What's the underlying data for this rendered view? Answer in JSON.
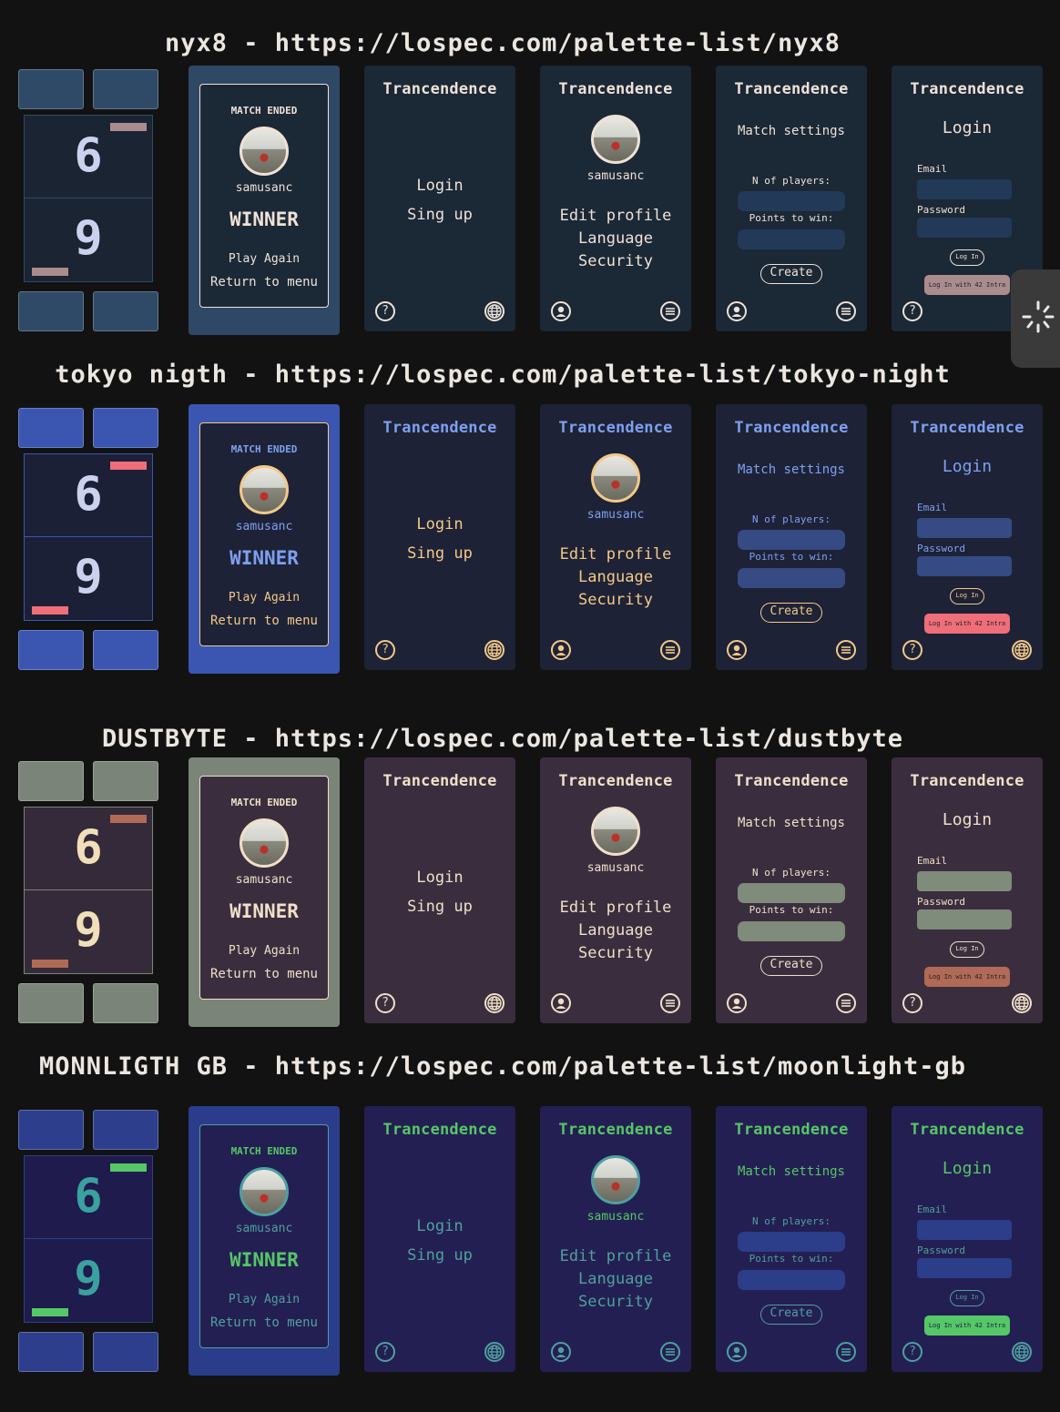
{
  "app": {
    "name": "Trancendence"
  },
  "screens": {
    "game": {
      "score_top": "6",
      "score_bottom": "9"
    },
    "match_end": {
      "header": "MATCH ENDED",
      "username": "samusanc",
      "result": "WINNER",
      "play_again": "Play Again",
      "return": "Return to menu"
    },
    "landing": {
      "login": "Login",
      "signup": "Sing up",
      "help_icon": "?"
    },
    "profile_menu": {
      "username": "samusanc",
      "items": [
        "Edit profile",
        "Language",
        "Security"
      ]
    },
    "match_settings": {
      "title": "Match settings",
      "players_label": "N of players:",
      "points_label": "Points to win:",
      "create": "Create"
    },
    "login": {
      "title": "Login",
      "email_label": "Email",
      "password_label": "Password",
      "login_btn": "Log In",
      "intra_btn": "Log In with 42 Intra",
      "help_icon": "?"
    }
  },
  "palettes": [
    {
      "title": "nyx8 - https://lospec.com/palette-list/nyx8",
      "colors": {
        "bg": "#1b2836",
        "text": "#efe2d6",
        "accent": "#ab8c8e",
        "btn": "#2f4a66",
        "field": "#223a57",
        "board": "#1a2432",
        "match_bg": "#2e4866"
      }
    },
    {
      "title": "tokyo nigth - https://lospec.com/palette-list/tokyo-night",
      "colors": {
        "bg": "#1e2236",
        "text": "#f3c988",
        "accent": "#ef6e7a",
        "btn": "#3b56b0",
        "field": "#364a84",
        "board": "#1c2036",
        "match_bg": "#3b56b0",
        "head": "#7da0f0"
      }
    },
    {
      "title": "DUSTBYTE - https://lospec.com/palette-list/dustbyte",
      "colors": {
        "bg": "#3a2e3e",
        "text": "#efe0c8",
        "accent": "#b06a55",
        "btn": "#7b8478",
        "field": "#7f8b7b",
        "board": "#352a3a",
        "match_bg": "#7b8478"
      }
    },
    {
      "title": "MONNLIGTH GB - https://lospec.com/palette-list/moonlight-gb",
      "colors": {
        "bg": "#241f52",
        "text": "#4ea0a0",
        "accent": "#55c766",
        "btn": "#2d3f8c",
        "field": "#2c3d8a",
        "board": "#1f1b4c",
        "match_bg": "#2a3c8a",
        "head": "#55c766"
      }
    }
  ]
}
